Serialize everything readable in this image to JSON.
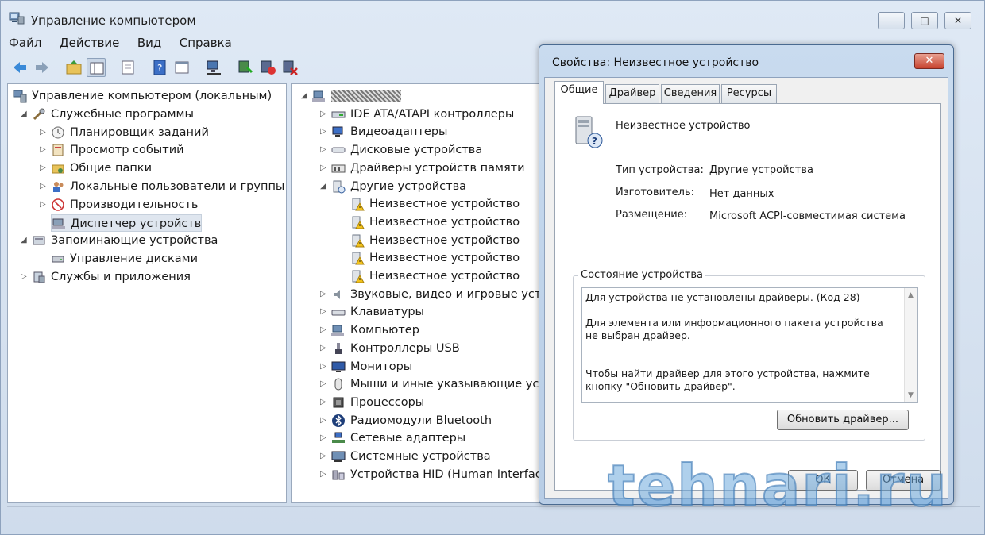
{
  "window": {
    "title": "Управление компьютером",
    "minimize": "–",
    "maximize": "□",
    "close": "✕"
  },
  "menu": [
    "Файл",
    "Действие",
    "Вид",
    "Справка"
  ],
  "left_tree": [
    {
      "label": "Управление компьютером (локальным)",
      "level": 0,
      "arrow": ""
    },
    {
      "label": "Служебные программы",
      "level": 1,
      "arrow": "◢"
    },
    {
      "label": "Планировщик заданий",
      "level": 2,
      "arrow": "▷"
    },
    {
      "label": "Просмотр событий",
      "level": 2,
      "arrow": "▷"
    },
    {
      "label": "Общие папки",
      "level": 2,
      "arrow": "▷"
    },
    {
      "label": "Локальные пользователи и группы",
      "level": 2,
      "arrow": "▷"
    },
    {
      "label": "Производительность",
      "level": 2,
      "arrow": "▷"
    },
    {
      "label": "Диспетчер устройств",
      "level": 2,
      "arrow": ""
    },
    {
      "label": "Запоминающие устройства",
      "level": 1,
      "arrow": "◢"
    },
    {
      "label": "Управление дисками",
      "level": 2,
      "arrow": ""
    },
    {
      "label": "Службы и приложения",
      "level": 1,
      "arrow": "▷"
    }
  ],
  "device_tree": [
    {
      "label": "",
      "level": 0,
      "arrow": "◢"
    },
    {
      "label": "IDE ATA/ATAPI контроллеры",
      "level": 1,
      "arrow": "▷"
    },
    {
      "label": "Видеоадаптеры",
      "level": 1,
      "arrow": "▷"
    },
    {
      "label": "Дисковые устройства",
      "level": 1,
      "arrow": "▷"
    },
    {
      "label": "Драйверы устройств памяти",
      "level": 1,
      "arrow": "▷"
    },
    {
      "label": "Другие устройства",
      "level": 1,
      "arrow": "◢"
    },
    {
      "label": "Неизвестное устройство",
      "level": 2,
      "arrow": ""
    },
    {
      "label": "Неизвестное устройство",
      "level": 2,
      "arrow": ""
    },
    {
      "label": "Неизвестное устройство",
      "level": 2,
      "arrow": ""
    },
    {
      "label": "Неизвестное устройство",
      "level": 2,
      "arrow": ""
    },
    {
      "label": "Неизвестное устройство",
      "level": 2,
      "arrow": ""
    },
    {
      "label": "Звуковые, видео и игровые устро",
      "level": 1,
      "arrow": "▷"
    },
    {
      "label": "Клавиатуры",
      "level": 1,
      "arrow": "▷"
    },
    {
      "label": "Компьютер",
      "level": 1,
      "arrow": "▷"
    },
    {
      "label": "Контроллеры USB",
      "level": 1,
      "arrow": "▷"
    },
    {
      "label": "Мониторы",
      "level": 1,
      "arrow": "▷"
    },
    {
      "label": "Мыши и иные указывающие устр",
      "level": 1,
      "arrow": "▷"
    },
    {
      "label": "Процессоры",
      "level": 1,
      "arrow": "▷"
    },
    {
      "label": "Радиомодули Bluetooth",
      "level": 1,
      "arrow": "▷"
    },
    {
      "label": "Сетевые адаптеры",
      "level": 1,
      "arrow": "▷"
    },
    {
      "label": "Системные устройства",
      "level": 1,
      "arrow": "▷"
    },
    {
      "label": "Устройства HID (Human Interface",
      "level": 1,
      "arrow": "▷"
    }
  ],
  "dialog": {
    "title": "Свойства: Неизвестное устройство",
    "close": "✕",
    "tabs": [
      "Общие",
      "Драйвер",
      "Сведения",
      "Ресурсы"
    ],
    "device_name": "Неизвестное устройство",
    "type_label": "Тип устройства:",
    "type_value": "Другие устройства",
    "maker_label": "Изготовитель:",
    "maker_value": "Нет данных",
    "location_label": "Размещение:",
    "location_value": "Microsoft ACPI-совместимая система",
    "status_group": "Состояние устройства",
    "status_text": "Для устройства не установлены драйверы. (Код 28)\n\nДля элемента или информационного пакета устройства не выбран драйвер.\n\n\nЧтобы найти драйвер для этого устройства, нажмите кнопку \"Обновить драйвер\".",
    "update_button": "Обновить драйвер...",
    "ok_button": "ОК",
    "cancel_button": "Отмена"
  },
  "watermark": "tehnari.ru",
  "colors": {
    "accent": "#3c7fc1",
    "warning": "#f2c21b",
    "titlebar": "#dfe9f5"
  }
}
